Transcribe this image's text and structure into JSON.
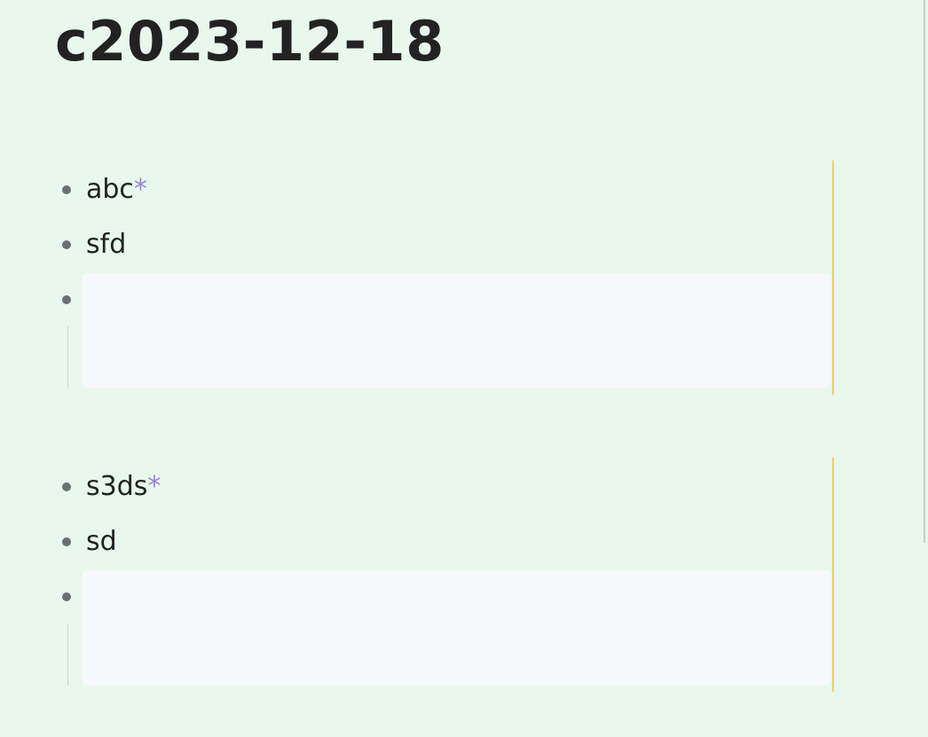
{
  "page": {
    "title": "c2023-12-18"
  },
  "blocks": [
    {
      "items": [
        {
          "text": "abc",
          "marker": "*"
        },
        {
          "text": "sfd",
          "marker": ""
        }
      ],
      "editor_value": ""
    },
    {
      "items": [
        {
          "text": "s3ds",
          "marker": "*"
        },
        {
          "text": "sd",
          "marker": ""
        }
      ],
      "editor_value": ""
    }
  ],
  "colors": {
    "background": "#e8f8ec",
    "text": "#222222",
    "bullet": "#6b6f73",
    "marker": "#9b7fd6",
    "editor_background": "#f7f8fa",
    "block_edge": "#f4cd6b"
  }
}
